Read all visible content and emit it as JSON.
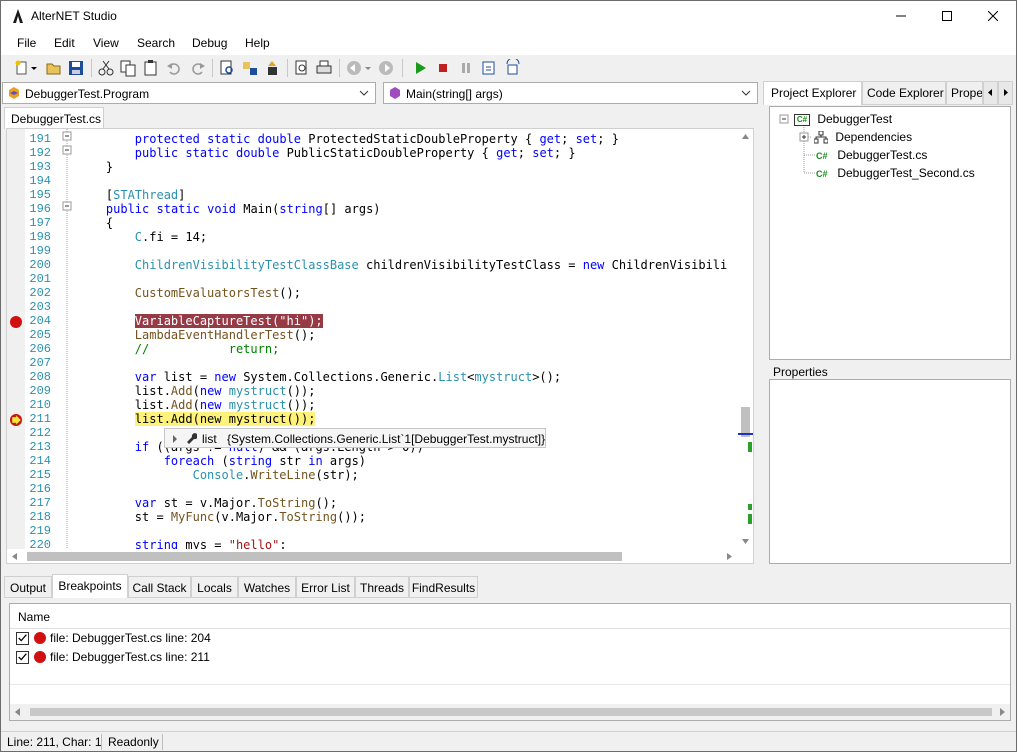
{
  "window": {
    "title": "AlterNET Studio",
    "minimize": "—",
    "maximize": "☐",
    "close": "✕"
  },
  "menu": [
    "File",
    "Edit",
    "View",
    "Search",
    "Debug",
    "Help"
  ],
  "toolbar_icons": [
    "new-file-icon",
    "open-icon",
    "save-icon",
    "cut-icon",
    "copy-icon",
    "paste-icon",
    "undo-icon",
    "redo-icon",
    "find-icon",
    "replace-icon",
    "goto-icon",
    "print-preview-icon",
    "print-icon",
    "back-icon",
    "forward-icon",
    "run-icon",
    "stop-icon",
    "pause-icon",
    "step-into-icon",
    "step-over-icon"
  ],
  "editor": {
    "class_combo": "DebuggerTest.Program",
    "member_combo": "Main(string[]  args)",
    "document_tab": "DebuggerTest.cs",
    "lines": [
      {
        "num": "191",
        "code": "        protected static double ProtectedStaticDoubleProperty { get; set; }"
      },
      {
        "num": "192",
        "code": "        public static double PublicStaticDoubleProperty { get; set; }"
      },
      {
        "num": "193",
        "code": "    }"
      },
      {
        "num": "194",
        "code": ""
      },
      {
        "num": "195",
        "code": "    [STAThread]"
      },
      {
        "num": "196",
        "code": "    public static void Main(string[] args)"
      },
      {
        "num": "197",
        "code": "    {"
      },
      {
        "num": "198",
        "code": "        C.fi = 14;"
      },
      {
        "num": "199",
        "code": ""
      },
      {
        "num": "200",
        "code": "        ChildrenVisibilityTestClassBase childrenVisibilityTestClass = new ChildrenVisibili"
      },
      {
        "num": "201",
        "code": ""
      },
      {
        "num": "202",
        "code": "        CustomEvaluatorsTest();"
      },
      {
        "num": "203",
        "code": ""
      },
      {
        "num": "204",
        "code": "        VariableCaptureTest(\"hi\");"
      },
      {
        "num": "205",
        "code": "        LambdaEventHandlerTest();"
      },
      {
        "num": "206",
        "code": "        //           return;"
      },
      {
        "num": "207",
        "code": ""
      },
      {
        "num": "208",
        "code": "        var list = new System.Collections.Generic.List<mystruct>();"
      },
      {
        "num": "209",
        "code": "        list.Add(new mystruct());"
      },
      {
        "num": "210",
        "code": "        list.Add(new mystruct());"
      },
      {
        "num": "211",
        "code": "        list.Add(new mystruct());"
      },
      {
        "num": "212",
        "code": ""
      },
      {
        "num": "213",
        "code": "        if ((args != null) && (args.Length > 0))"
      },
      {
        "num": "214",
        "code": "            foreach (string str in args)"
      },
      {
        "num": "215",
        "code": "                Console.WriteLine(str);"
      },
      {
        "num": "216",
        "code": ""
      },
      {
        "num": "217",
        "code": "        var st = v.Major.ToString();"
      },
      {
        "num": "218",
        "code": "        st = MyFunc(v.Major.ToString());"
      },
      {
        "num": "219",
        "code": ""
      },
      {
        "num": "220",
        "code": "        string mys = \"hello\";"
      }
    ],
    "tooltip": {
      "name": "list",
      "value": "{System.Collections.Generic.List`1[DebuggerTest.mystruct]}"
    }
  },
  "right_panel": {
    "tabs": [
      "Project Explorer",
      "Code Explorer",
      "Prope"
    ],
    "tree": {
      "root": "DebuggerTest",
      "children": [
        "Dependencies",
        "DebuggerTest.cs",
        "DebuggerTest_Second.cs"
      ]
    },
    "properties_label": "Properties"
  },
  "bottom_panel": {
    "tabs": [
      "Output",
      "Breakpoints",
      "Call Stack",
      "Locals",
      "Watches",
      "Error List",
      "Threads",
      "FindResults"
    ],
    "active_tab": "Breakpoints",
    "column_header": "Name",
    "rows": [
      {
        "checked": true,
        "text": "file: DebuggerTest.cs line: 204"
      },
      {
        "checked": true,
        "text": "file: DebuggerTest.cs line: 211"
      }
    ]
  },
  "status": {
    "position": "Line: 211, Char: 1",
    "mode": "Readonly"
  },
  "colors": {
    "breakpoint": "#d01010",
    "breakpoint_line": "#963a46",
    "current_line": "#fff27a",
    "keyword": "#0000ff",
    "type": "#2b91af"
  }
}
